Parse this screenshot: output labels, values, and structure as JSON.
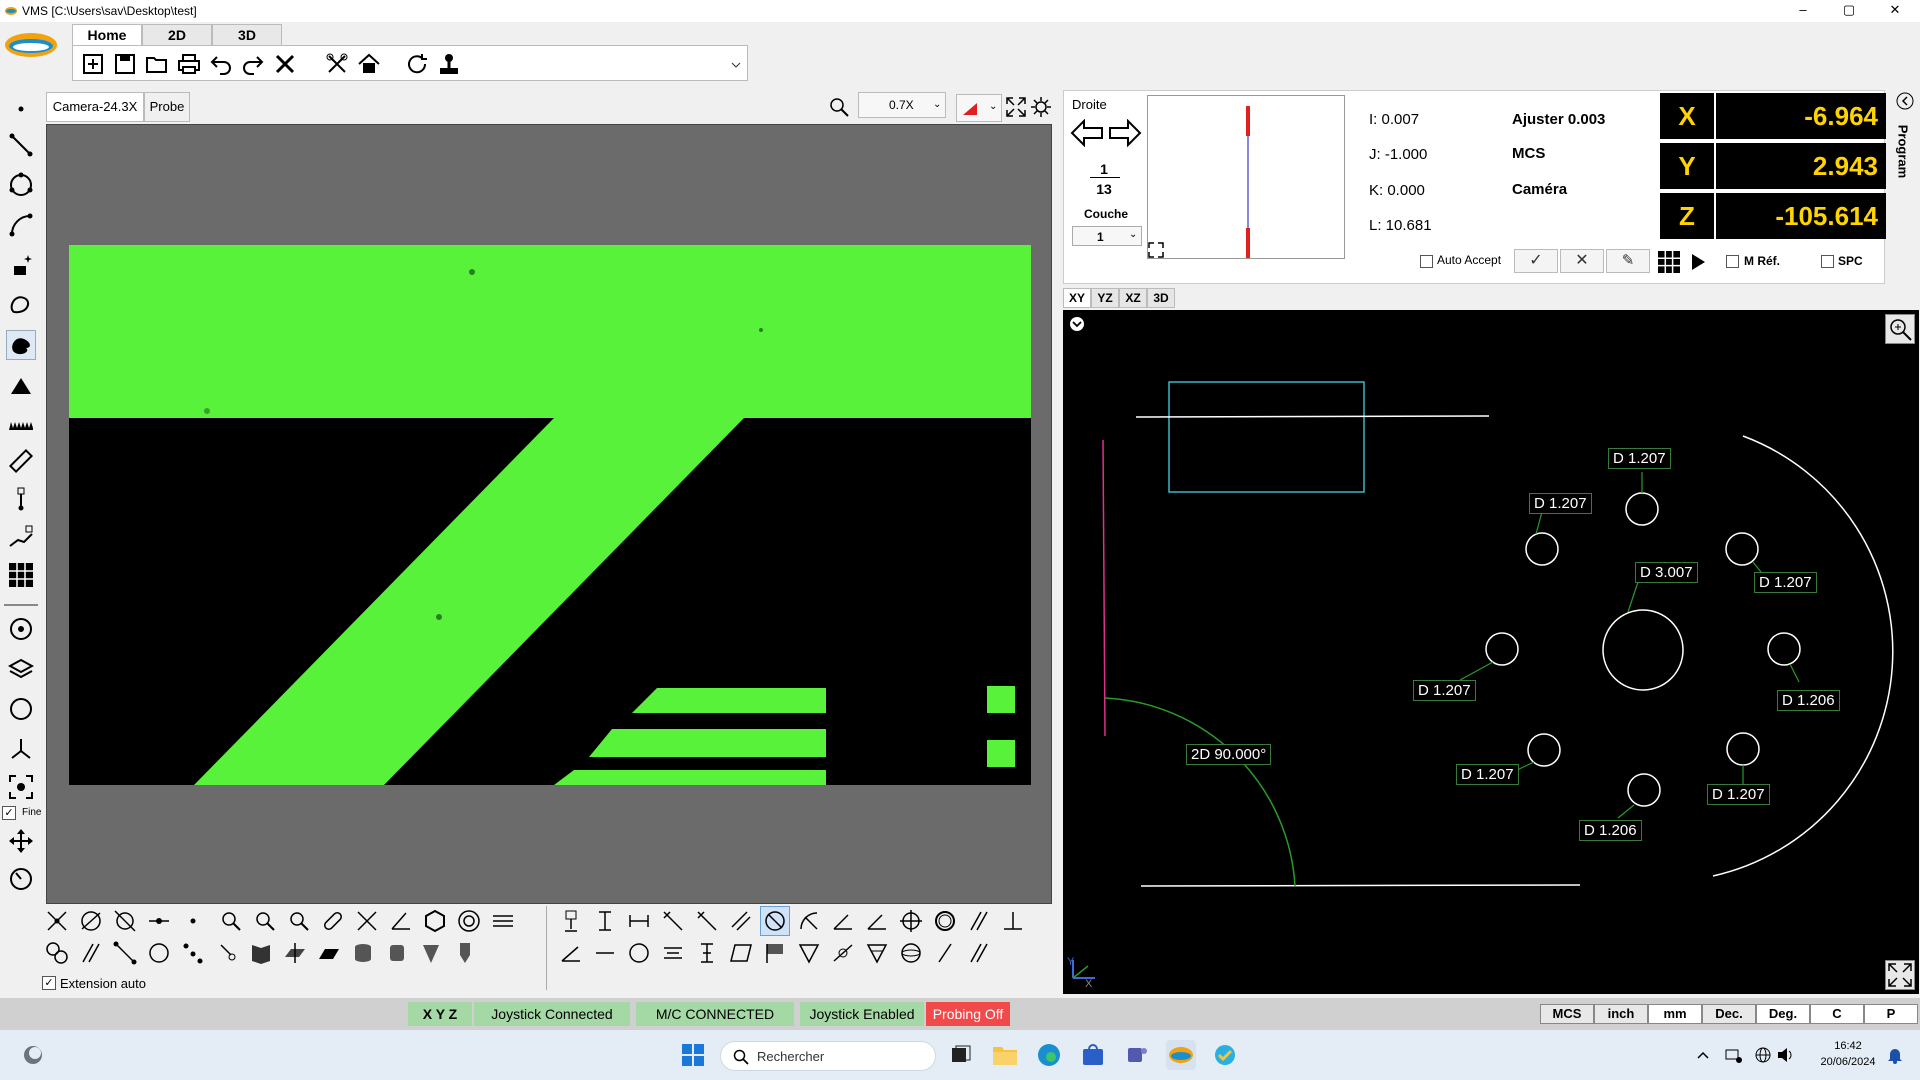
{
  "window": {
    "title": "VMS  [C:\\Users\\sav\\Desktop\\test]",
    "minimize": "–",
    "maximize": "▢",
    "close": "✕"
  },
  "ribbon": {
    "tabs": [
      "Home",
      "2D",
      "3D"
    ]
  },
  "camera": {
    "tab_camera": "Camera-24.3X",
    "tab_probe": "Probe",
    "zoom": "0.7X"
  },
  "palette": {
    "extension_auto": "Extension auto"
  },
  "left_tools": {
    "fine_label": "Fine"
  },
  "feature": {
    "type": "Droite",
    "index": "1",
    "count": "13",
    "layer_label": "Couche",
    "layer_value": "1",
    "i": "I: 0.007",
    "j": "J: -1.000",
    "k": "K: 0.000",
    "l": "L: 10.681",
    "ajuster": "Ajuster 0.003",
    "mcs": "MCS",
    "camera": "Caméra",
    "auto_accept": "Auto Accept",
    "m_ref": "M Réf.",
    "spc": "SPC"
  },
  "dro": {
    "x_label": "X",
    "x": "-6.964",
    "y_label": "Y",
    "y": "2.943",
    "z_label": "Z",
    "z": "-105.614"
  },
  "program_tab": "Program",
  "view": {
    "tabs": [
      "XY",
      "YZ",
      "XZ",
      "3D"
    ],
    "axis_x": "X",
    "axis_y": "Y"
  },
  "dims": [
    {
      "t": "D 1.207"
    },
    {
      "t": "D 1.207"
    },
    {
      "t": "D 3.007"
    },
    {
      "t": "D 1.207"
    },
    {
      "t": "D 1.207"
    },
    {
      "t": "D 1.206"
    },
    {
      "t": "D 1.207"
    },
    {
      "t": "D 1.207"
    },
    {
      "t": "D 1.206"
    },
    {
      "t": "2D  90.000°"
    }
  ],
  "status": {
    "xyz": "X  Y  Z",
    "joystick_connected": "Joystick Connected",
    "mc_connected": "M/C CONNECTED",
    "joystick_enabled": "Joystick Enabled",
    "probing": "Probing Off",
    "units": [
      "MCS",
      "inch",
      "mm",
      "Dec.",
      "Deg.",
      "C",
      "P"
    ]
  },
  "taskbar": {
    "search": "Rechercher",
    "time": "16:42",
    "date": "20/06/2024"
  },
  "colors": {
    "green": "#58f23a",
    "dro_text": "#ffd400",
    "probing": "#f04a4a",
    "status_green": "#a4d8a4"
  }
}
